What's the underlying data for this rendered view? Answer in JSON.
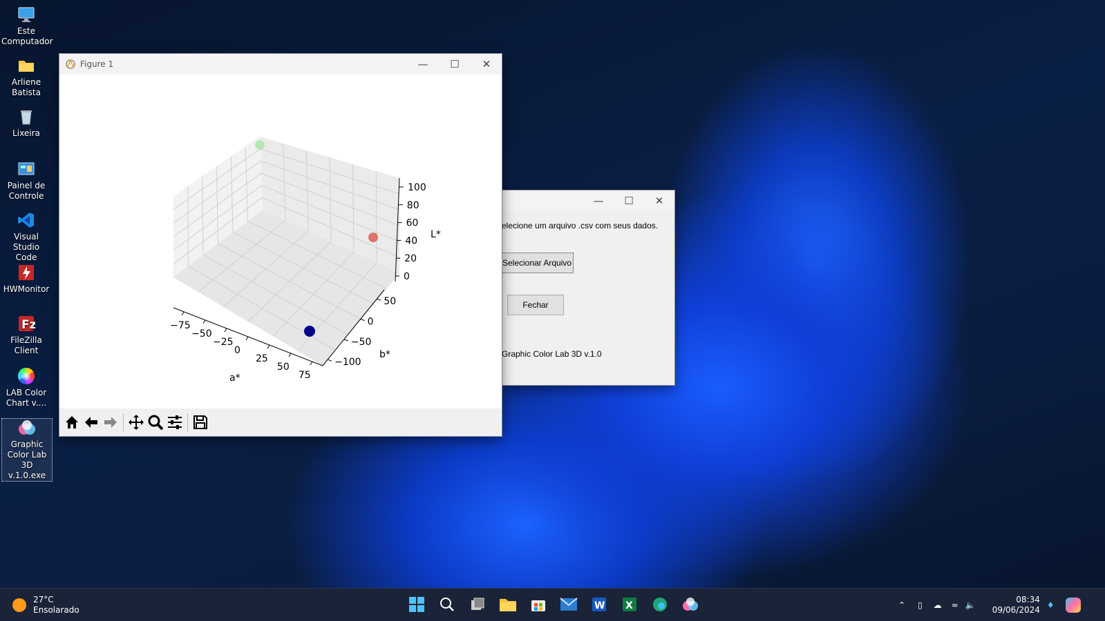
{
  "desktop": {
    "icons": [
      {
        "label": "Este Computador"
      },
      {
        "label": "Arliene Batista"
      },
      {
        "label": "Lixeira"
      },
      {
        "label": "Painel de Controle"
      },
      {
        "label": "Visual Studio Code"
      },
      {
        "label": "HWMonitor"
      },
      {
        "label": "FileZilla Client"
      },
      {
        "label": "LAB Color Chart v...."
      },
      {
        "label": "Graphic Color Lab 3D v.1.0.exe"
      }
    ]
  },
  "figure_window": {
    "title": "Figure 1",
    "plot": {
      "z_label": "L*",
      "x_label": "a*",
      "y_label": "b*",
      "z_ticks": [
        "100",
        "80",
        "60",
        "40",
        "20",
        "0"
      ],
      "x_ticks": [
        "−75",
        "−50",
        "−25",
        "0",
        "25",
        "50",
        "75"
      ],
      "y_ticks": [
        "50",
        "0",
        "−50",
        "−100"
      ]
    },
    "toolbar": [
      "home-icon",
      "back-icon",
      "forward-icon",
      "pan-icon",
      "zoom-icon",
      "configure-icon",
      "save-icon"
    ]
  },
  "chart_data": {
    "type": "scatter",
    "points": [
      {
        "color": "#a8e6a3",
        "label": "light green"
      },
      {
        "color": "#d9534f",
        "label": "red"
      },
      {
        "color": "#00008b",
        "label": "dark blue"
      }
    ],
    "xlabel": "a*",
    "ylabel": "b*",
    "zlabel": "L*",
    "zlim": [
      0,
      100
    ]
  },
  "dialog": {
    "message": "elecione um arquivo .csv com seus dados.",
    "select_button": "Selecionar Arquivo",
    "close_button": "Fechar",
    "footer": "Graphic Color Lab 3D v.1.0"
  },
  "taskbar": {
    "weather_temp": "27°C",
    "weather_desc": "Ensolarado",
    "time": "08:34",
    "date": "09/06/2024"
  },
  "colors": {
    "accent": "#0a5fff",
    "taskbar": "#1a2338"
  }
}
